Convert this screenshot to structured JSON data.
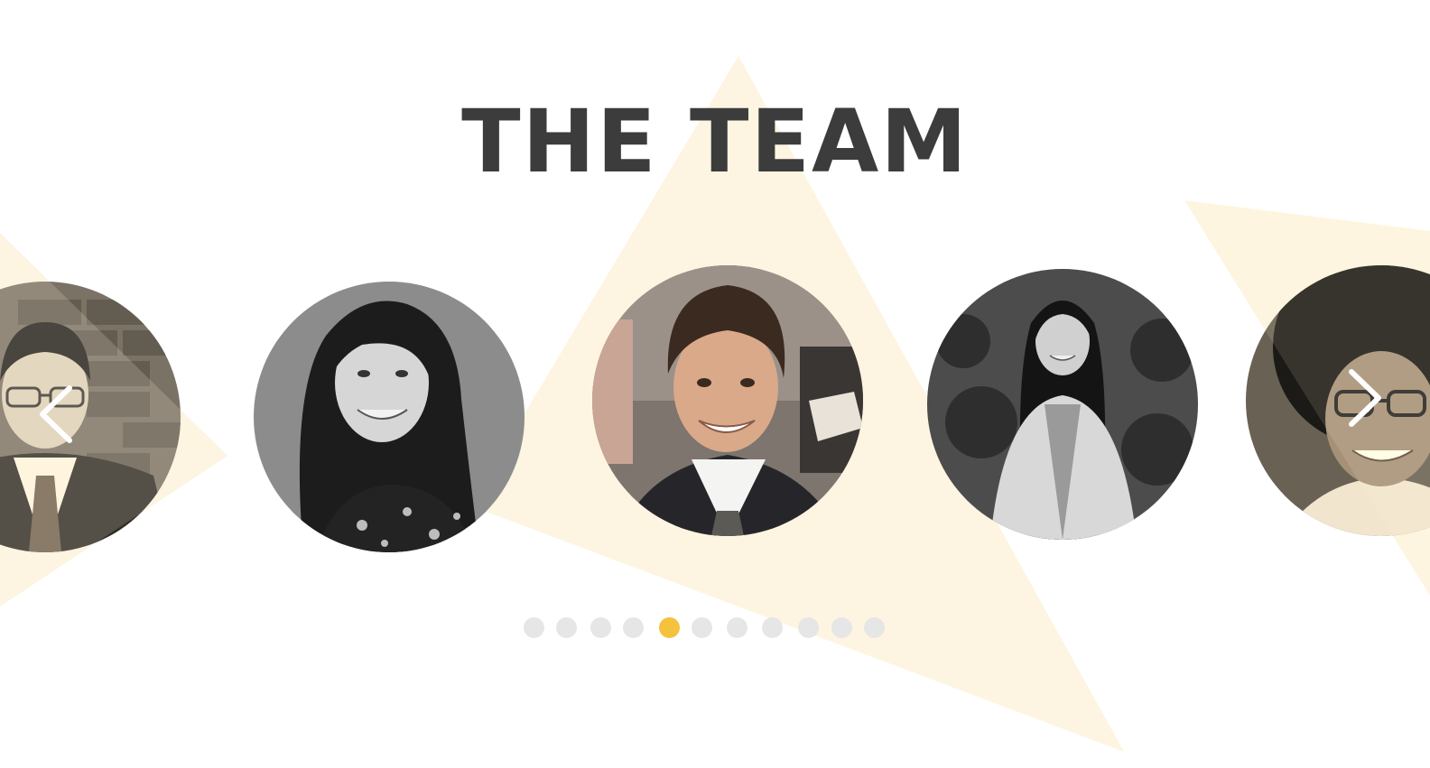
{
  "section": {
    "title": "THE TEAM"
  },
  "colors": {
    "title": "#3c3c3c",
    "accent": "#f5c23e",
    "shape": "#fdf5e1",
    "dot_inactive": "#e6e6e6",
    "arrow": "#ffffff"
  },
  "carousel": {
    "members": [
      {
        "name": "team-member-photo-1",
        "style": "sepia"
      },
      {
        "name": "team-member-photo-2",
        "style": "grayscale"
      },
      {
        "name": "team-member-photo-3",
        "style": "color"
      },
      {
        "name": "team-member-photo-4",
        "style": "grayscale"
      },
      {
        "name": "team-member-photo-5",
        "style": "sepia"
      }
    ],
    "prev_icon": "chevron-left-icon",
    "next_icon": "chevron-right-icon",
    "slide_count": 11,
    "active_slide": 5
  }
}
